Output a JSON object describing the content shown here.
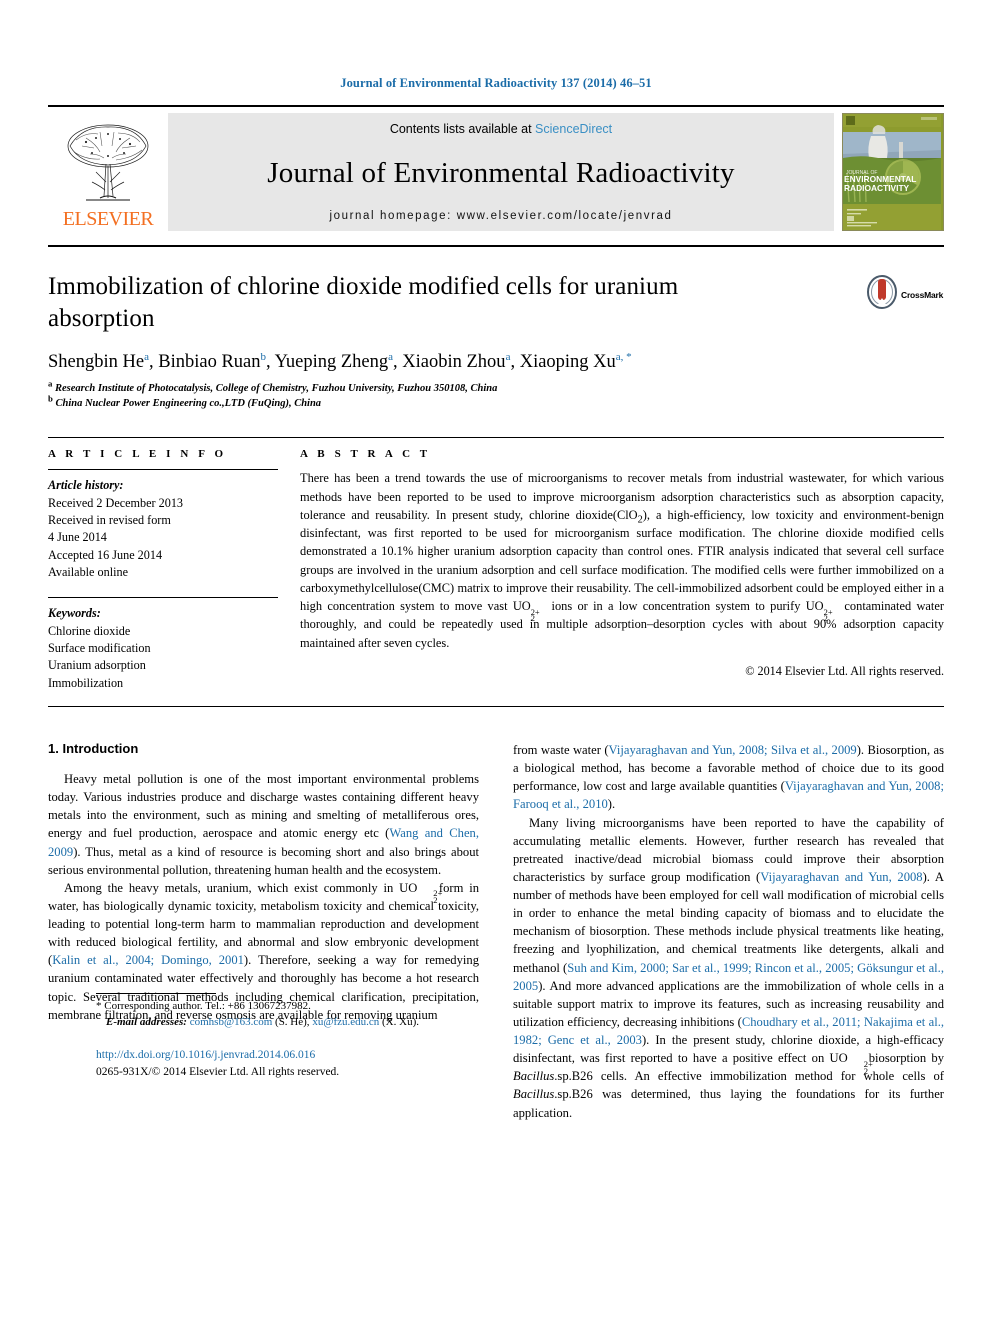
{
  "running_head": "Journal of Environmental Radioactivity 137 (2014) 46–51",
  "masthead": {
    "publisher": "ELSEVIER",
    "contents_prefix": "Contents lists available at",
    "contents_link": "ScienceDirect",
    "journal_title": "Journal of Environmental Radioactivity",
    "homepage": "journal homepage: www.elsevier.com/locate/jenvrad",
    "cover_title_line1": "JOURNAL OF",
    "cover_title_line2": "ENVIRONMENTAL",
    "cover_title_line3": "RADIOACTIVITY"
  },
  "article": {
    "title": "Immobilization of chlorine dioxide modified cells for uranium absorption",
    "crossmark_label": "CrossMark",
    "authors": [
      {
        "name": "Shengbin He",
        "marks": "a"
      },
      {
        "name": "Binbiao Ruan",
        "marks": "b"
      },
      {
        "name": "Yueping Zheng",
        "marks": "a"
      },
      {
        "name": "Xiaobin Zhou",
        "marks": "a"
      },
      {
        "name": "Xiaoping Xu",
        "marks": "a, *"
      }
    ],
    "affiliations": [
      {
        "mark": "a",
        "text": "Research Institute of Photocatalysis, College of Chemistry, Fuzhou University, Fuzhou 350108, China"
      },
      {
        "mark": "b",
        "text": "China Nuclear Power Engineering co.,LTD (FuQing), China"
      }
    ]
  },
  "info": {
    "heading": "A R T I C L E   I N F O",
    "history_label": "Article history:",
    "history": [
      "Received 2 December 2013",
      "Received in revised form",
      "4 June 2014",
      "Accepted 16 June 2014",
      "Available online"
    ],
    "keywords_label": "Keywords:",
    "keywords": [
      "Chlorine dioxide",
      "Surface modification",
      "Uranium adsorption",
      "Immobilization"
    ]
  },
  "abstract": {
    "heading": "A B S T R A C T",
    "p1_a": "There has been a trend towards the use of microorganisms to recover metals from industrial wastewater, for which various methods have been reported to be used to improve microorganism adsorption characteristics such as absorption capacity, tolerance and reusability. In present study, chlorine dioxide(ClO",
    "p1_sub": "2",
    "p1_b": "), a high-efficiency, low toxicity and environment-benign disinfectant, was first reported to be used for microorganism surface modification. The chlorine dioxide modified cells demonstrated a 10.1% higher uranium adsorption capacity than control ones. FTIR analysis indicated that several cell surface groups are involved in the uranium adsorption and cell surface modification. The modified cells were further immobilized on a carboxymethylcellulose(CMC) matrix to improve their reusability. The cell-immobilized adsorbent could be employed either in a high concentration system to move vast UO",
    "p1_c": " ions or in a low concentration system to purify UO",
    "p1_d": " contaminated water thoroughly, and could be repeatedly used in multiple adsorption–desorption cycles with about 90% adsorption capacity maintained after seven cycles.",
    "copyright": "© 2014 Elsevier Ltd. All rights reserved."
  },
  "intro": {
    "heading": "1.  Introduction",
    "left": {
      "p1_a": "Heavy metal pollution is one of the most important environmental problems today. Various industries produce and discharge wastes containing different heavy metals into the environment, such as mining and smelting of metalliferous ores, energy and fuel production, aerospace and atomic energy etc (",
      "p1_cite": "Wang and Chen, 2009",
      "p1_b": "). Thus, metal as a kind of resource is becoming short and also brings about serious environmental pollution, threatening human health and the ecosystem.",
      "p2_a": "Among the heavy metals, uranium, which exist commonly in UO",
      "p2_b": " form in water, has biologically dynamic toxicity, metabolism toxicity and chemical toxicity, leading to potential long-term harm to mammalian reproduction and development with reduced biological fertility, and abnormal and slow embryonic development (",
      "p2_cite": "Kalin et al., 2004; Domingo, 2001",
      "p2_c": "). Therefore, seeking a way for remedying uranium contaminated water effectively and thoroughly has become a hot research topic. Several traditional methods including chemical clarification, precipitation, membrane filtration, and reverse osmosis are available for removing uranium"
    },
    "right": {
      "p1_a": "from waste water (",
      "p1_cite1": "Vijayaraghavan and Yun, 2008; Silva et al., 2009",
      "p1_b": "). Biosorption, as a biological method, has become a favorable method of choice due to its good performance, low cost and large available quantities (",
      "p1_cite2": "Vijayaraghavan and Yun, 2008; Farooq et al., 2010",
      "p1_c": ").",
      "p2_a": "Many living microorganisms have been reported to have the capability of accumulating metallic elements. However, further research has revealed that pretreated inactive/dead microbial biomass could improve their absorption characteristics by surface group modification (",
      "p2_cite1": "Vijayaraghavan and Yun, 2008",
      "p2_b": "). A number of methods have been employed for cell wall modification of microbial cells in order to enhance the metal binding capacity of biomass and to elucidate the mechanism of biosorption. These methods include physical treatments like heating, freezing and lyophilization, and chemical treatments like detergents, alkali and methanol (",
      "p2_cite2": "Suh and Kim, 2000; Sar et al., 1999; Rincon et al., 2005; Göksungur et al., 2005",
      "p2_c": "). And more advanced applications are the immobilization of whole cells in a suitable support matrix to improve its features, such as increasing reusability and utilization efficiency, decreasing inhibitions (",
      "p2_cite3": "Choudhary et al., 2011; Nakajima et al., 1982; Genc et al., 2003",
      "p2_d": "). In the present study, chlorine dioxide, a high-efficacy disinfectant, was first reported to have a positive effect on UO",
      "p2_e": " biosorption by ",
      "p2_ital1": "Bacillus",
      "p2_f": ".sp.B26 cells. An effective immobilization method for whole cells of ",
      "p2_ital2": "Bacillus",
      "p2_g": ".sp.B26 was determined, thus laying the foundations for its further application."
    }
  },
  "footnote": {
    "corresponding": "* Corresponding author. Tel.: +86 13067237982.",
    "email_label": "E-mail addresses:",
    "email1": "comhsb@163.com",
    "email1_person": "(S. He),",
    "email2": "xu@fzu.edu.cn",
    "email2_person": "(X. Xu).",
    "doi": "http://dx.doi.org/10.1016/j.jenvrad.2014.06.016",
    "issn_line": "0265-931X/© 2014 Elsevier Ltd. All rights reserved."
  },
  "colors": {
    "link": "#1b6ca8",
    "elsevier_orange": "#f36f21",
    "masthead_bg": "#e7e7e7",
    "cover_green": "#8a9a2b"
  }
}
